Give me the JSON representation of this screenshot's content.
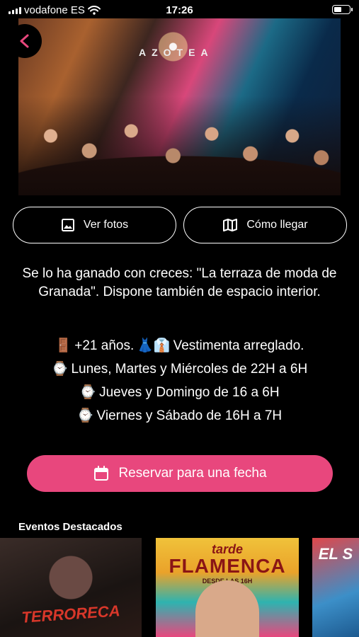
{
  "status_bar": {
    "carrier": "vodafone ES",
    "time": "17:26"
  },
  "hero": {
    "sign_text": "AZOTEA"
  },
  "buttons": {
    "photos_label": "Ver fotos",
    "directions_label": "Cómo llegar",
    "reserve_label": "Reservar para una fecha"
  },
  "description": "Se lo ha ganado con creces: \"La terraza de moda de Granada\". Dispone también de espacio interior.",
  "info": {
    "age": "+21 años.",
    "dress": "Vestimenta arreglado.",
    "schedule_1": "Lunes, Martes y Miércoles de 22H a 6H",
    "schedule_2": "Jueves y Domingo de 16 a 6H",
    "schedule_3": "Viernes y Sábado de 16H a 7H"
  },
  "events": {
    "title": "Eventos Destacados",
    "cards": [
      {
        "text": "TERRORECA"
      },
      {
        "text_top": "tarde",
        "text_main": "FLAMENCA",
        "text_sub": "DESDE LAS 16H"
      },
      {
        "text": "EL S"
      }
    ]
  },
  "colors": {
    "accent": "#e8477d",
    "background": "#000000"
  }
}
